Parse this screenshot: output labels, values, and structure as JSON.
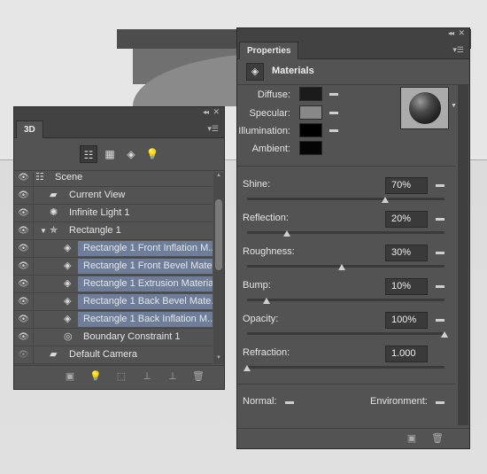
{
  "panel3d": {
    "tab": "3D",
    "toolbar": [
      {
        "icon": "scene-filter-icon",
        "active": true
      },
      {
        "icon": "mesh-filter-icon",
        "active": false
      },
      {
        "icon": "material-filter-icon",
        "active": false
      },
      {
        "icon": "light-filter-icon",
        "active": false
      }
    ],
    "rows": [
      {
        "label": "Scene",
        "icon": "scene-icon",
        "glyph": "☷",
        "indent": 46,
        "iconx": 24,
        "selected": false,
        "eye": true
      },
      {
        "label": "Current View",
        "icon": "camera-icon",
        "glyph": "▰",
        "indent": 62,
        "iconx": 40,
        "selected": false,
        "eye": true
      },
      {
        "label": "Infinite Light 1",
        "icon": "infinite-light-icon",
        "glyph": "✺",
        "indent": 62,
        "iconx": 40,
        "selected": false,
        "eye": true
      },
      {
        "label": "Rectangle 1",
        "icon": "mesh-icon",
        "glyph": "✯",
        "indent": 62,
        "iconx": 40,
        "selected": false,
        "eye": true,
        "expand": "▼"
      },
      {
        "label": "Rectangle 1 Front Inflation M...",
        "icon": "material-icon",
        "glyph": "◈",
        "indent": 78,
        "iconx": 56,
        "selected": true,
        "eye": true
      },
      {
        "label": "Rectangle 1 Front Bevel Mate...",
        "icon": "material-icon",
        "glyph": "◈",
        "indent": 78,
        "iconx": 56,
        "selected": true,
        "eye": true
      },
      {
        "label": "Rectangle 1 Extrusion Material",
        "icon": "material-icon",
        "glyph": "◈",
        "indent": 78,
        "iconx": 56,
        "selected": true,
        "eye": true
      },
      {
        "label": "Rectangle 1 Back Bevel Mate...",
        "icon": "material-icon",
        "glyph": "◈",
        "indent": 78,
        "iconx": 56,
        "selected": true,
        "eye": true
      },
      {
        "label": "Rectangle 1 Back Inflation M...",
        "icon": "material-icon",
        "glyph": "◈",
        "indent": 78,
        "iconx": 56,
        "selected": true,
        "eye": true
      },
      {
        "label": "Boundary Constraint 1",
        "icon": "constraint-icon",
        "glyph": "◎",
        "indent": 78,
        "iconx": 56,
        "selected": false,
        "eye": true
      },
      {
        "label": "Default Camera",
        "icon": "camera-icon",
        "glyph": "▰",
        "indent": 62,
        "iconx": 40,
        "selected": false,
        "eye": false
      }
    ],
    "bottom_icons": [
      "render-icon",
      "add-light-icon",
      "new-mesh-icon",
      "ground-plane-icon",
      "drop-to-plane-icon",
      "trash-icon"
    ]
  },
  "properties": {
    "tab": "Properties",
    "section": "Materials",
    "textures": [
      {
        "label": "Diffuse:",
        "color": "#1b1b1b"
      },
      {
        "label": "Specular:",
        "color": "#888888"
      },
      {
        "label": "Illumination:",
        "color": "#000000"
      },
      {
        "label": "Ambient:",
        "color": "#050505"
      }
    ],
    "sliders": [
      {
        "label": "Shine:",
        "value": "70%",
        "level": 0.7
      },
      {
        "label": "Reflection:",
        "value": "20%",
        "level": 0.2
      },
      {
        "label": "Roughness:",
        "value": "30%",
        "level": 0.48
      },
      {
        "label": "Bump:",
        "value": "10%",
        "level": 0.1
      },
      {
        "label": "Opacity:",
        "value": "100%",
        "level": 1.0
      },
      {
        "label": "Refraction:",
        "value": "1.000",
        "level": 0.0
      }
    ],
    "normal_label": "Normal:",
    "environment_label": "Environment:",
    "footer_icons": [
      "render-icon",
      "trash-icon"
    ]
  }
}
